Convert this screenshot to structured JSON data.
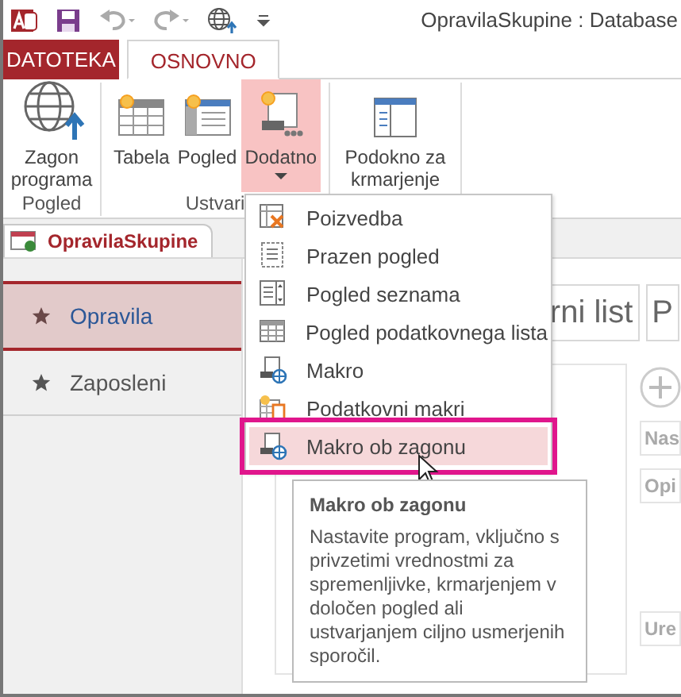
{
  "title_bar": {
    "quick_access": [
      {
        "kind": "app"
      },
      {
        "kind": "save"
      },
      {
        "kind": "undo"
      },
      {
        "kind": "redo"
      },
      {
        "kind": "globe"
      },
      {
        "kind": "customize"
      }
    ],
    "title": "OpravilaSkupine : Database"
  },
  "ribbon_tabs": [
    {
      "label": "DATOTEKA",
      "kind": "file",
      "selected": false
    },
    {
      "label": "OSNOVNO",
      "kind": "tab",
      "selected": true
    }
  ],
  "ribbon_groups": [
    {
      "label": "Pogled",
      "buttons": [
        {
          "label": "Zagon programa",
          "kind": "globe",
          "pressed": false,
          "dropdown": false
        }
      ]
    },
    {
      "label": "Ustvari",
      "buttons": [
        {
          "label": "Tabela",
          "kind": "table",
          "pressed": false,
          "dropdown": false
        },
        {
          "label": "Pogled",
          "kind": "form",
          "pressed": false,
          "dropdown": false
        },
        {
          "label": "Dodatno",
          "kind": "advanced",
          "pressed": true,
          "dropdown": true
        }
      ]
    },
    {
      "buttons": [
        {
          "label": "Podokno za krmarjenje",
          "kind": "navpane",
          "pressed": false,
          "dropdown": false
        }
      ]
    }
  ],
  "document_tab": {
    "label": "OpravilaSkupine"
  },
  "navigation": {
    "items": [
      {
        "label": "Opravila",
        "selected": true
      },
      {
        "label": "Zaposleni",
        "selected": false
      }
    ]
  },
  "content": {
    "tabs": [
      {
        "label": "rni list"
      },
      {
        "label": "P"
      }
    ],
    "fields": [
      {
        "label": "Nas"
      },
      {
        "label": "Opi"
      },
      {
        "label": "Ure"
      }
    ]
  },
  "dropdown_menu": {
    "items": [
      {
        "label": "Poizvedba",
        "kind": "query",
        "highlighted": false
      },
      {
        "label": "Prazen pogled",
        "kind": "blank",
        "highlighted": false
      },
      {
        "label": "Pogled seznama",
        "kind": "list",
        "highlighted": false
      },
      {
        "label": "Pogled podatkovnega lista",
        "kind": "datasheet",
        "highlighted": false
      },
      {
        "label": "Makro",
        "kind": "macro",
        "highlighted": false
      },
      {
        "label": "Podatkovni makri",
        "kind": "data_macro",
        "highlighted": false
      },
      {
        "label": "Makro ob zagonu",
        "kind": "macro",
        "highlighted": true
      }
    ]
  },
  "tooltip": {
    "title": "Makro ob zagonu",
    "text": "Nastavite program, vključno s privzetimi vrednostmi za spremenljivke, krmarjenjem v določen pogled ali ustvarjanjem ciljno usmerjenih sporočil."
  }
}
